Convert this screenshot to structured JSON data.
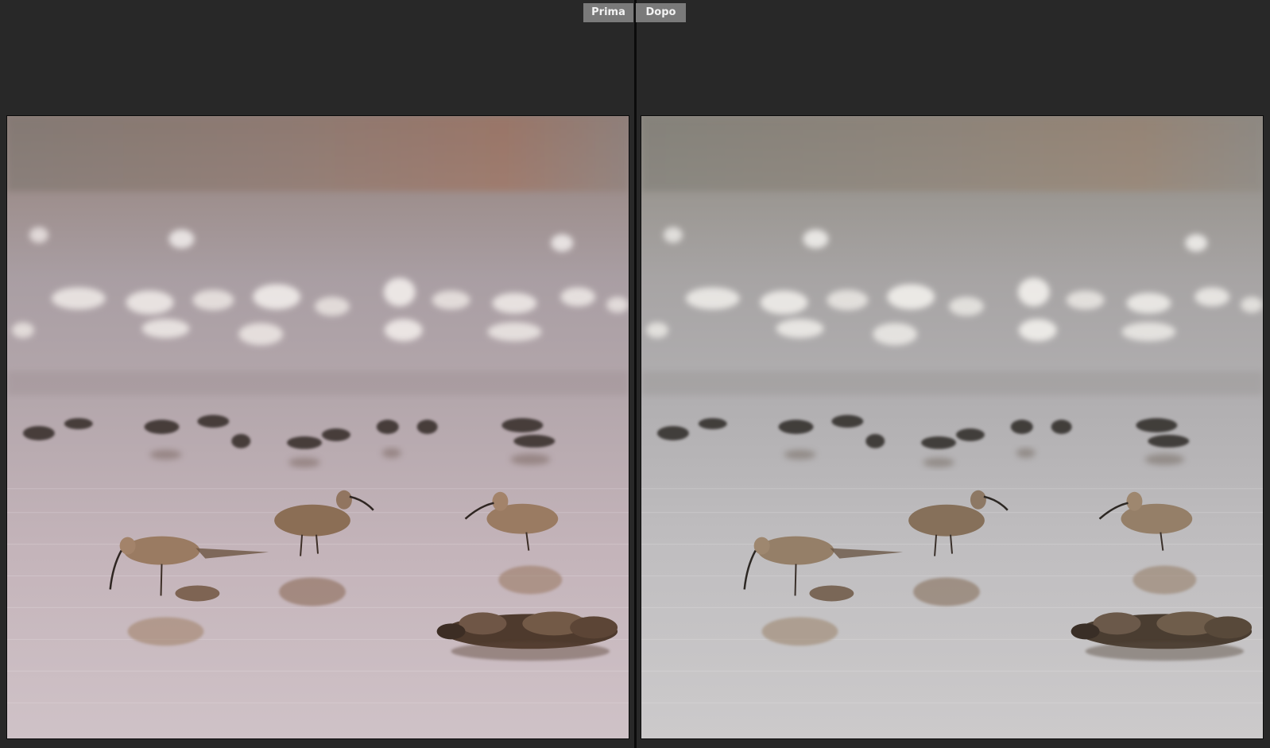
{
  "compare": {
    "before_label": "Prima",
    "after_label": "Dopo"
  },
  "colors": {
    "background": "#282828",
    "tab_background": "#7a7a7a",
    "tab_text": "#f2f2f2",
    "divider": "#0b0b0b"
  },
  "photos": {
    "before": {
      "style": "warm",
      "tone": "#bdb0b5"
    },
    "after": {
      "style": "neutral",
      "tone": "#bcbcbe"
    }
  }
}
